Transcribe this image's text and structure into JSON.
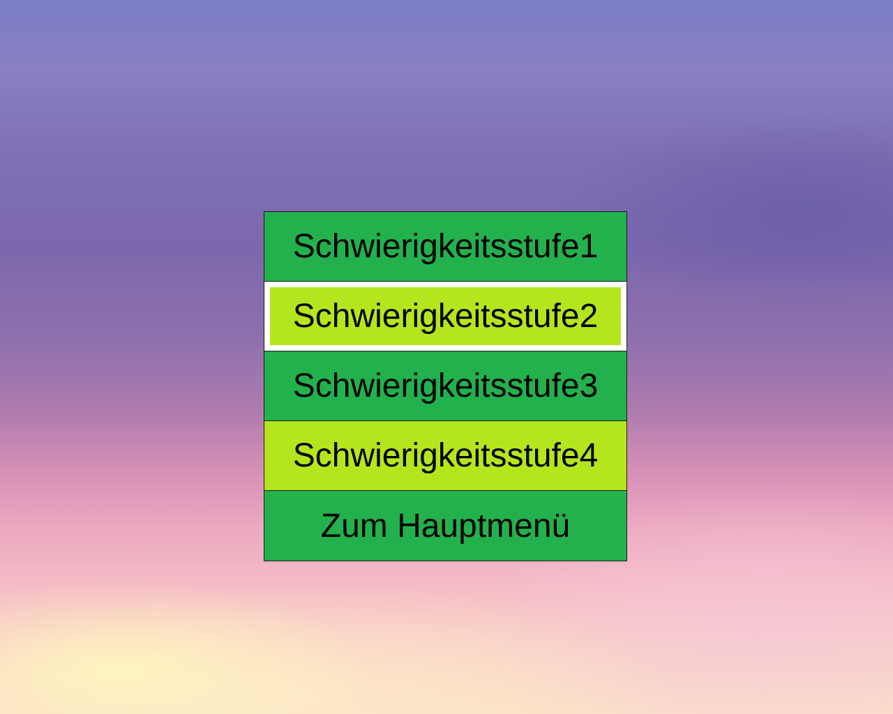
{
  "menu": {
    "items": [
      {
        "label": "Schwierigkeitsstufe1"
      },
      {
        "label": "Schwierigkeitsstufe2"
      },
      {
        "label": "Schwierigkeitsstufe3"
      },
      {
        "label": "Schwierigkeitsstufe4"
      },
      {
        "label": "Zum Hauptmenü"
      }
    ],
    "selected_index": 1,
    "colors": {
      "dark_green": "#23b14d",
      "light_green": "#b5e61d",
      "highlight": "#ffffff"
    }
  }
}
